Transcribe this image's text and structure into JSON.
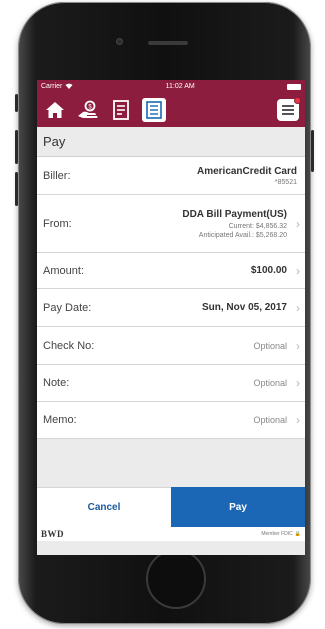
{
  "status_bar": {
    "carrier": "Carrier",
    "time": "11:02 AM"
  },
  "nav": {
    "icons": [
      "home-icon",
      "payee-hand-icon",
      "bills-icon",
      "pay-list-icon"
    ],
    "active": "pay-list-icon",
    "menu_icon": "menu-icon",
    "accent_color": "#8c1d3e"
  },
  "page": {
    "title": "Pay"
  },
  "form": {
    "biller": {
      "label": "Biller:",
      "name": "AmericanCredit Card",
      "account": "*85521"
    },
    "from": {
      "label": "From:",
      "account": "DDA Bill Payment(US)",
      "current": "Current: $4,856.32",
      "anticipated": "Anticipated Avail.: $5,268.20"
    },
    "amount": {
      "label": "Amount:",
      "value": "$100.00"
    },
    "pay_date": {
      "label": "Pay Date:",
      "value": "Sun, Nov 05, 2017"
    },
    "check_no": {
      "label": "Check No:",
      "value": "Optional"
    },
    "note": {
      "label": "Note:",
      "value": "Optional"
    },
    "memo": {
      "label": "Memo:",
      "value": "Optional"
    }
  },
  "actions": {
    "cancel_label": "Cancel",
    "pay_label": "Pay",
    "pay_color": "#1c67b5"
  },
  "footer": {
    "logo": "BWD",
    "fdic": "Member FDIC"
  }
}
